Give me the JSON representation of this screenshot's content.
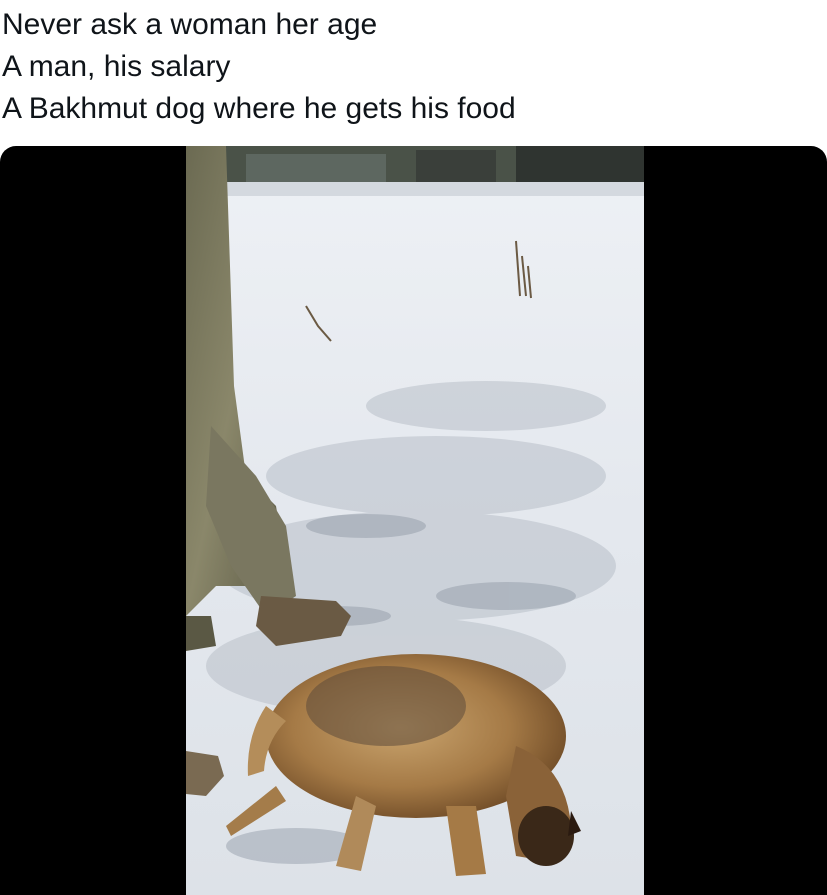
{
  "post": {
    "caption_lines": [
      "Never ask a woman her age",
      "A man, his salary",
      "A Bakhmut dog where he gets his food"
    ]
  },
  "media": {
    "type": "video-still",
    "subject": "dog lying in snow beside a soldier's boot"
  },
  "colors": {
    "text": "#0f1419",
    "background": "#ffffff",
    "letterbox": "#000000",
    "snow": "#e8ecf0",
    "dog_fur": "#b08a5a"
  }
}
